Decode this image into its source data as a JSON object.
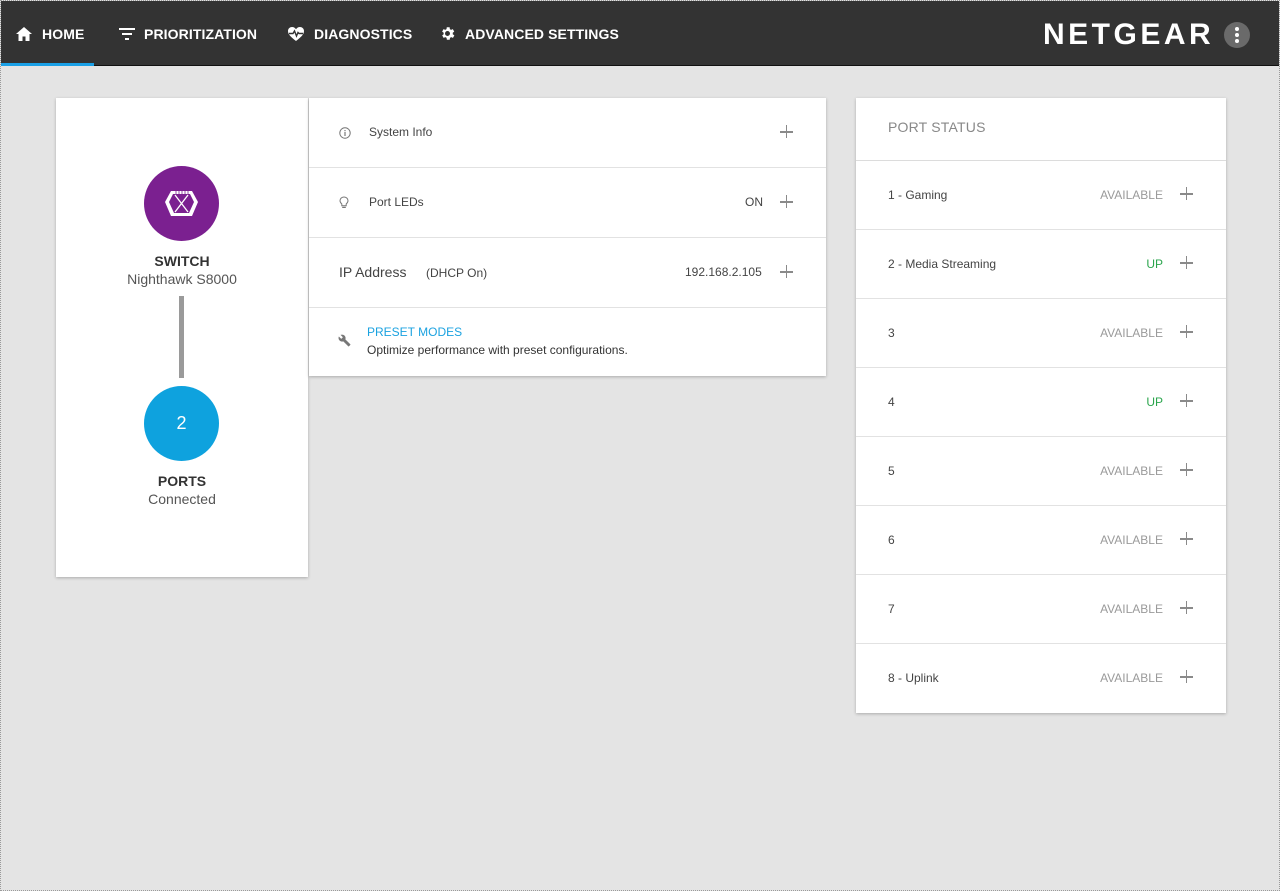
{
  "nav": {
    "items": [
      {
        "label": "HOME",
        "icon": "home-icon",
        "active": true
      },
      {
        "label": "PRIORITIZATION",
        "icon": "filter-icon"
      },
      {
        "label": "DIAGNOSTICS",
        "icon": "heart-pulse-icon"
      },
      {
        "label": "ADVANCED SETTINGS",
        "icon": "gear-icon"
      }
    ],
    "brand": "NETGEAR",
    "accent_color": "#1aa0e6"
  },
  "summary": {
    "switch_title": "SWITCH",
    "switch_model": "Nighthawk S8000",
    "switch_color": "#7b2090",
    "ports_count": "2",
    "ports_title": "PORTS",
    "ports_sub": "Connected",
    "ports_color": "#0ea2de"
  },
  "info": {
    "system_info": "System Info",
    "port_leds_label": "Port LEDs",
    "port_leds_value": "ON",
    "ip_label": "IP Address",
    "ip_mode": "(DHCP On)",
    "ip_value": "192.168.2.105",
    "preset_title": "PRESET MODES",
    "preset_desc": "Optimize performance with preset configurations."
  },
  "port_status": {
    "header": "PORT STATUS",
    "ports": [
      {
        "name": "1 - Gaming",
        "status": "AVAILABLE"
      },
      {
        "name": "2 - Media Streaming",
        "status": "UP"
      },
      {
        "name": "3",
        "status": "AVAILABLE"
      },
      {
        "name": "4",
        "status": "UP"
      },
      {
        "name": "5",
        "status": "AVAILABLE"
      },
      {
        "name": "6",
        "status": "AVAILABLE"
      },
      {
        "name": "7",
        "status": "AVAILABLE"
      },
      {
        "name": "8 - Uplink",
        "status": "AVAILABLE"
      }
    ],
    "up_color": "#2aa54c",
    "available_color": "#9a9a9a"
  }
}
